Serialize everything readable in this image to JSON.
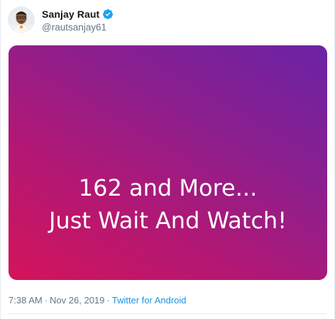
{
  "author": {
    "display_name": "Sanjay Raut",
    "handle": "@rautsanjay61",
    "verified": true,
    "verified_icon": "verified-badge-icon",
    "verified_color": "#1da1f2"
  },
  "media": {
    "line1": "162 and More...",
    "line2": "Just Wait And Watch!",
    "gradient_colors": [
      "#d4145a",
      "#6a23a5"
    ]
  },
  "meta": {
    "time": "7:38 AM",
    "date": "Nov 26, 2019",
    "separator": "·",
    "source": "Twitter for Android",
    "link_color": "#1b95e0"
  }
}
